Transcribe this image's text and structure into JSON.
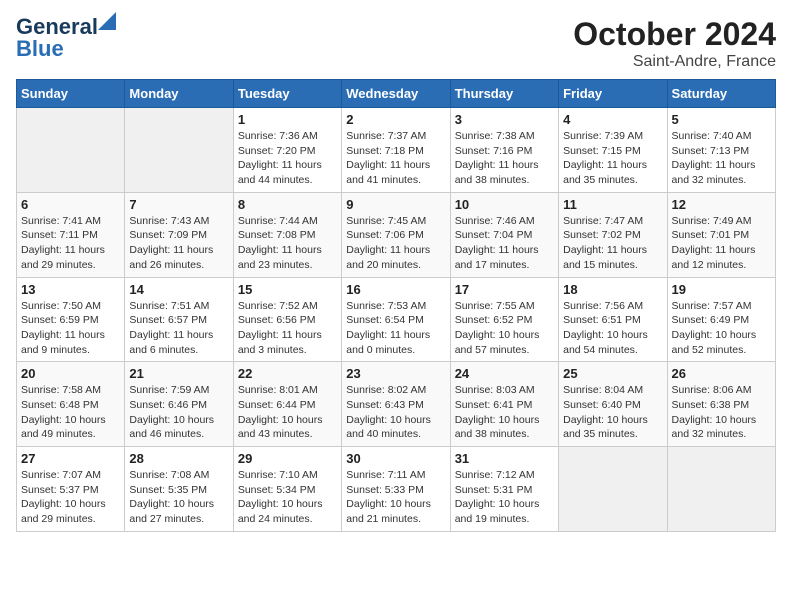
{
  "logo": {
    "line1": "General",
    "line2": "Blue"
  },
  "title": "October 2024",
  "subtitle": "Saint-Andre, France",
  "headers": [
    "Sunday",
    "Monday",
    "Tuesday",
    "Wednesday",
    "Thursday",
    "Friday",
    "Saturday"
  ],
  "weeks": [
    [
      {
        "num": "",
        "info": ""
      },
      {
        "num": "",
        "info": ""
      },
      {
        "num": "1",
        "info": "Sunrise: 7:36 AM\nSunset: 7:20 PM\nDaylight: 11 hours and 44 minutes."
      },
      {
        "num": "2",
        "info": "Sunrise: 7:37 AM\nSunset: 7:18 PM\nDaylight: 11 hours and 41 minutes."
      },
      {
        "num": "3",
        "info": "Sunrise: 7:38 AM\nSunset: 7:16 PM\nDaylight: 11 hours and 38 minutes."
      },
      {
        "num": "4",
        "info": "Sunrise: 7:39 AM\nSunset: 7:15 PM\nDaylight: 11 hours and 35 minutes."
      },
      {
        "num": "5",
        "info": "Sunrise: 7:40 AM\nSunset: 7:13 PM\nDaylight: 11 hours and 32 minutes."
      }
    ],
    [
      {
        "num": "6",
        "info": "Sunrise: 7:41 AM\nSunset: 7:11 PM\nDaylight: 11 hours and 29 minutes."
      },
      {
        "num": "7",
        "info": "Sunrise: 7:43 AM\nSunset: 7:09 PM\nDaylight: 11 hours and 26 minutes."
      },
      {
        "num": "8",
        "info": "Sunrise: 7:44 AM\nSunset: 7:08 PM\nDaylight: 11 hours and 23 minutes."
      },
      {
        "num": "9",
        "info": "Sunrise: 7:45 AM\nSunset: 7:06 PM\nDaylight: 11 hours and 20 minutes."
      },
      {
        "num": "10",
        "info": "Sunrise: 7:46 AM\nSunset: 7:04 PM\nDaylight: 11 hours and 17 minutes."
      },
      {
        "num": "11",
        "info": "Sunrise: 7:47 AM\nSunset: 7:02 PM\nDaylight: 11 hours and 15 minutes."
      },
      {
        "num": "12",
        "info": "Sunrise: 7:49 AM\nSunset: 7:01 PM\nDaylight: 11 hours and 12 minutes."
      }
    ],
    [
      {
        "num": "13",
        "info": "Sunrise: 7:50 AM\nSunset: 6:59 PM\nDaylight: 11 hours and 9 minutes."
      },
      {
        "num": "14",
        "info": "Sunrise: 7:51 AM\nSunset: 6:57 PM\nDaylight: 11 hours and 6 minutes."
      },
      {
        "num": "15",
        "info": "Sunrise: 7:52 AM\nSunset: 6:56 PM\nDaylight: 11 hours and 3 minutes."
      },
      {
        "num": "16",
        "info": "Sunrise: 7:53 AM\nSunset: 6:54 PM\nDaylight: 11 hours and 0 minutes."
      },
      {
        "num": "17",
        "info": "Sunrise: 7:55 AM\nSunset: 6:52 PM\nDaylight: 10 hours and 57 minutes."
      },
      {
        "num": "18",
        "info": "Sunrise: 7:56 AM\nSunset: 6:51 PM\nDaylight: 10 hours and 54 minutes."
      },
      {
        "num": "19",
        "info": "Sunrise: 7:57 AM\nSunset: 6:49 PM\nDaylight: 10 hours and 52 minutes."
      }
    ],
    [
      {
        "num": "20",
        "info": "Sunrise: 7:58 AM\nSunset: 6:48 PM\nDaylight: 10 hours and 49 minutes."
      },
      {
        "num": "21",
        "info": "Sunrise: 7:59 AM\nSunset: 6:46 PM\nDaylight: 10 hours and 46 minutes."
      },
      {
        "num": "22",
        "info": "Sunrise: 8:01 AM\nSunset: 6:44 PM\nDaylight: 10 hours and 43 minutes."
      },
      {
        "num": "23",
        "info": "Sunrise: 8:02 AM\nSunset: 6:43 PM\nDaylight: 10 hours and 40 minutes."
      },
      {
        "num": "24",
        "info": "Sunrise: 8:03 AM\nSunset: 6:41 PM\nDaylight: 10 hours and 38 minutes."
      },
      {
        "num": "25",
        "info": "Sunrise: 8:04 AM\nSunset: 6:40 PM\nDaylight: 10 hours and 35 minutes."
      },
      {
        "num": "26",
        "info": "Sunrise: 8:06 AM\nSunset: 6:38 PM\nDaylight: 10 hours and 32 minutes."
      }
    ],
    [
      {
        "num": "27",
        "info": "Sunrise: 7:07 AM\nSunset: 5:37 PM\nDaylight: 10 hours and 29 minutes."
      },
      {
        "num": "28",
        "info": "Sunrise: 7:08 AM\nSunset: 5:35 PM\nDaylight: 10 hours and 27 minutes."
      },
      {
        "num": "29",
        "info": "Sunrise: 7:10 AM\nSunset: 5:34 PM\nDaylight: 10 hours and 24 minutes."
      },
      {
        "num": "30",
        "info": "Sunrise: 7:11 AM\nSunset: 5:33 PM\nDaylight: 10 hours and 21 minutes."
      },
      {
        "num": "31",
        "info": "Sunrise: 7:12 AM\nSunset: 5:31 PM\nDaylight: 10 hours and 19 minutes."
      },
      {
        "num": "",
        "info": ""
      },
      {
        "num": "",
        "info": ""
      }
    ]
  ]
}
